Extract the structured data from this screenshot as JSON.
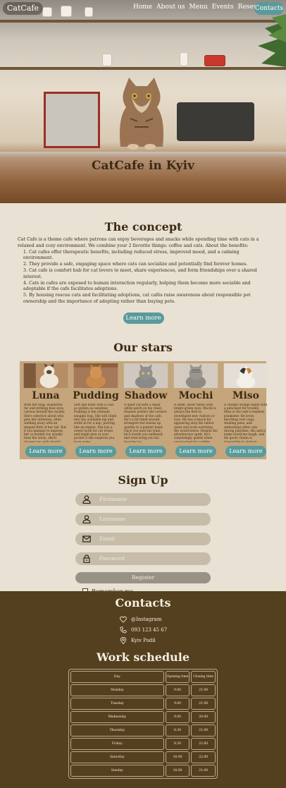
{
  "nav": {
    "logo": "CatCafe",
    "links": [
      "Home",
      "About us",
      "Menu",
      "Events",
      "Reservation"
    ],
    "contacts_button": "Contacts"
  },
  "hero": {
    "title": "CatCafe in Kyiv"
  },
  "concept": {
    "title": "The concept",
    "intro": "Cat Cafe is a theme cafe where patrons can enjoy beverages and snacks while spending time with cats in a relaxed and cozy environment. We combine your 2 favorite things: coffee and cats. About the benefits:",
    "items": [
      "1. Cat cafes offer therapeutic benefits, including reduced stress, improved mood, and a calming environment.",
      "2. They provide a safe, engaging space where cats can socialize and potentially find forever homes.",
      "3. Cat cafe is comfort hub for cat lovers to meet, share experiences, and form friendships over a shared interest.",
      "4. Cats in cafes are exposed to human interaction regularly, helping them become more sociable and adoptable if the cafe facilitates adoptions.",
      "5. By housing rescue cats and facilitating adoptions, cat cafés raise awareness about responsible pet ownership and the importance of adopting rather than buying pets."
    ],
    "button": "Learn more"
  },
  "stars": {
    "title": "Our stars",
    "cards": [
      {
        "name": "Luna",
        "desc": "With her long, wonderful fur and striking blue eyes, curious herself the royalty. She's selective about who gets her attention, often walking away with an elegant flick of her tail. But if you manage to impress her (a feather toy usually does the trick), she'll shower you with playful antics and purrs.",
        "button": "Learn more"
      },
      {
        "name": "Pudding",
        "desc": "Soft and fluffy with a coat as golden as sunshine, Pudding is the ultimate snuggle bug. She will climb into any available lap and settle in for a nap, purring like an engine. She has a sweet tooth for cat treats and might give at your pocket if she suspects you have some.",
        "button": "Learn more"
      },
      {
        "name": "Shadow",
        "desc": "A quiet cat with a small white patch on his chest, Shadow prefers the corners and shadows of the cafe. He's a bit timid around strangers but warms up quickly to a patient hand. Once you earn his trust, he'll nuzzle you endlessly and even bring you his favorite toy.",
        "button": "Learn more"
      },
      {
        "name": "Mochi",
        "desc": "A sleek, silver tabby with bright green eyes, Mochi is always the first to investigate new visitors or toys. He has a knack for appearing atop the tallest spots and loves watching the world below. Despite his adventurous spirit, he's surprisingly gentle when approached for cuddles.",
        "button": "Learn more"
      },
      {
        "name": "Miso",
        "desc": "A chunky orange tabby with a penchant for trouble, Miso is the cafe's resident prankster. He loves knocking over cups, stealing pens, and ambushing other cats during playtime. His antics make everyone laugh, and his goofy charm is irresistible to visitors.",
        "button": "Learn more"
      }
    ]
  },
  "signup": {
    "title": "Sign Up",
    "fields": [
      {
        "placeholder": "Firstname",
        "icon": "user-icon"
      },
      {
        "placeholder": "Lastname",
        "icon": "user-icon"
      },
      {
        "placeholder": "Email",
        "icon": "mail-icon"
      },
      {
        "placeholder": "Password",
        "icon": "lock-icon"
      }
    ],
    "register_button": "Register",
    "remember_label": "Remember me"
  },
  "contacts": {
    "title": "Contacts",
    "items": [
      {
        "icon": "heart-icon",
        "text": "@Instagram"
      },
      {
        "icon": "phone-icon",
        "text": "093 123 45 67"
      },
      {
        "icon": "location-icon",
        "text": "Kyiv Podil"
      }
    ]
  },
  "schedule": {
    "title": "Work schedule",
    "headers": [
      "Day",
      "Opening time",
      "Closing time"
    ],
    "rows": [
      [
        "Monday",
        "9.00",
        "21.00"
      ],
      [
        "Tuesday",
        "9.00",
        "21.00"
      ],
      [
        "Wednesday",
        "9.00",
        "20.00"
      ],
      [
        "Thursday",
        "8.30",
        "21.00"
      ],
      [
        "Friday",
        "8.30",
        "22.00"
      ],
      [
        "Saturday",
        "10.00",
        "22.00"
      ],
      [
        "Sunday",
        "10.00",
        "21.00"
      ]
    ]
  },
  "colors": {
    "accent": "#5a9a9a",
    "footer_bg": "#54401f",
    "page_bg": "#e8e1d4",
    "cards_bg": "#c4a57c"
  }
}
